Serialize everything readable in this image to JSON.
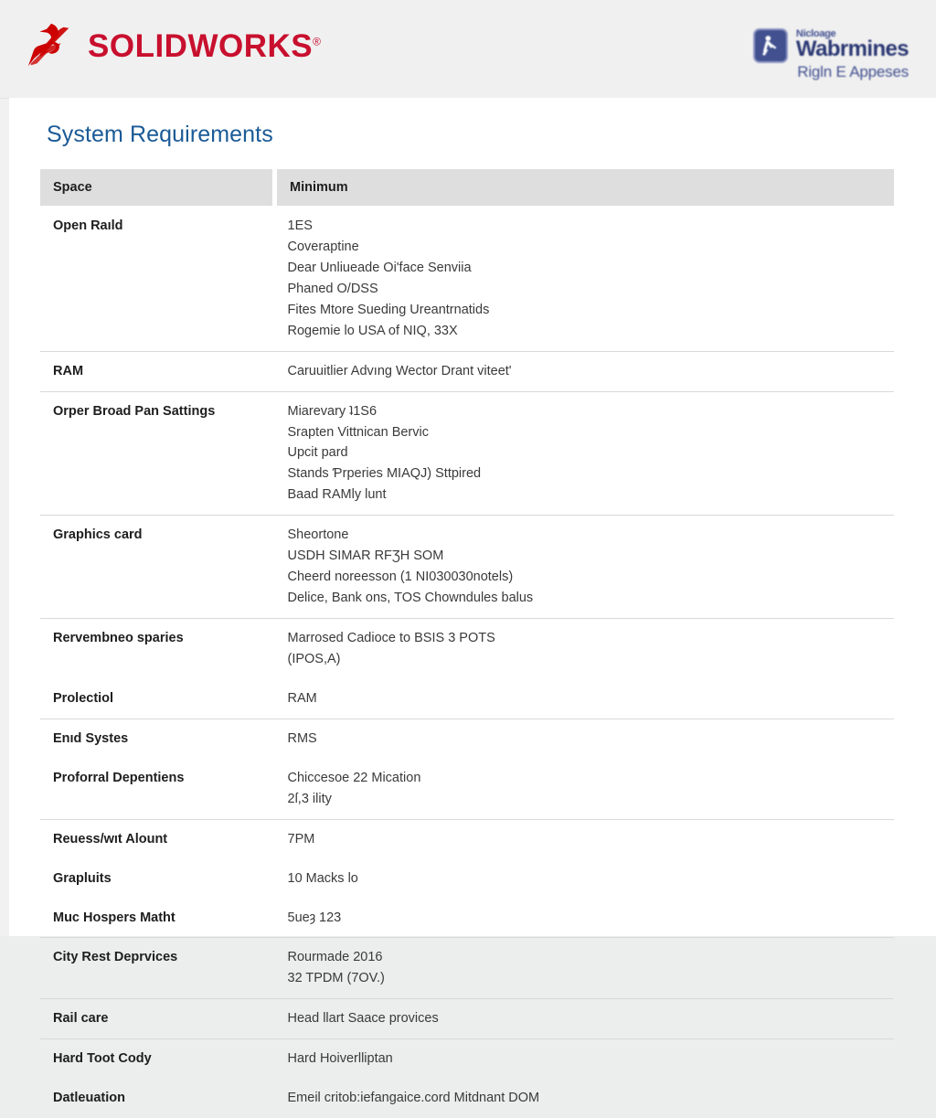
{
  "header": {
    "brand_name": "SOLIDWORKS",
    "brand_registered": "®",
    "brand_logo_icon": "ds-swoosh-logo-icon",
    "partner": {
      "badge_icon": "partner-badge-icon",
      "line_small": "Nicloage",
      "line_big": "Wabrmines",
      "line_sub": "Rigln E Appeses"
    }
  },
  "main": {
    "title": "System Requirements",
    "table": {
      "columns": [
        "Space",
        "Minimum"
      ],
      "rows": [
        {
          "label": "Open Raıld",
          "values": [
            "1ES",
            "Coveraptine",
            "Dear Unliueade Oi'face Senviia",
            "Phaned O/DSS",
            "Fites Mtore Sueding Ureantrnatids",
            "Rogemie lo USA of NIQ, 33X"
          ],
          "divider_above": false
        },
        {
          "label": "RAM",
          "values": [
            "Caruuitlier Advıng Wector Drant viteet'"
          ],
          "divider_above": true
        },
        {
          "label": "Orper Broad Pan Sattings",
          "values": [
            "Miarevary ʇ1S6",
            "Srapten Vittnican Bervic",
            "Upcit pard",
            "Stands Ƥrperies MIAQJ) Sttpired",
            "Baad RAMly lunt"
          ],
          "divider_above": true
        },
        {
          "label": "Graphics card",
          "values": [
            "Sheortone",
            "USDH SIMAR RFƷH SOM",
            "Cheerd noreesson (1 NI030030notels)",
            "Delice, Bank ons, TOS Chowndules balus"
          ],
          "divider_above": true
        },
        {
          "label": "Rervembneo sparies",
          "values": [
            "Marrosed Cadioce to BSIS 3 POTS",
            "(IPOS,A)"
          ],
          "divider_above": true
        },
        {
          "label": "Prolectiol",
          "values": [
            "RAM"
          ],
          "divider_above": false
        },
        {
          "label": "Enıd Systes",
          "values": [
            "RMS"
          ],
          "divider_above": true
        },
        {
          "label": "Proforral Depentiens",
          "values": [
            "Chiccesoe 22 Mication",
            "2ſ,3 ility"
          ],
          "divider_above": false
        },
        {
          "label": "Reuess/wıt Alount",
          "values": [
            "7PM"
          ],
          "divider_above": true
        },
        {
          "label": "Grapluits",
          "values": [
            "10 Macks lo"
          ],
          "divider_above": false
        },
        {
          "label": "Muc Hospers Matht",
          "values": [
            "5ueȝ 123"
          ],
          "divider_above": false
        },
        {
          "label": "City Rest Deprvices",
          "values": [
            "Rourmade 2016",
            "32 TPDM (7OV.)"
          ],
          "divider_above": true
        },
        {
          "label": "Rail care",
          "values": [
            "Head llart Saace provices"
          ],
          "divider_above": true
        },
        {
          "label": "Hard Toot Cody",
          "values": [
            "Hard Hoiverlliptan"
          ],
          "divider_above": true
        },
        {
          "label": "Datleuation",
          "values": [
            "Emeil critob:iefangaice.cord Mitdnant DOM"
          ],
          "divider_above": false
        }
      ]
    }
  },
  "colors": {
    "brand_red": "#c8102e",
    "title_blue": "#1a5a96",
    "header_gray": "#dedede",
    "partner_navy": "#23306e",
    "body_text": "#3a3a3a"
  }
}
